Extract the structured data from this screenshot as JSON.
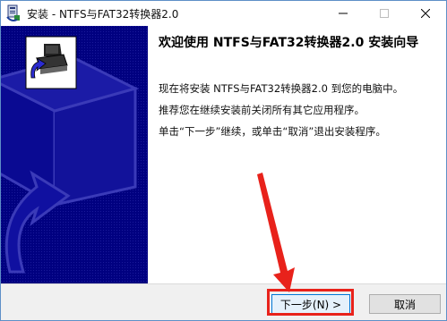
{
  "window": {
    "title": "安装 - NTFS与FAT32转换器2.0",
    "accent": "#000080"
  },
  "titlebar_icons": [
    "app-installer-icon",
    "minimize-icon",
    "maximize-icon",
    "close-icon"
  ],
  "content": {
    "heading": "欢迎使用 NTFS与FAT32转换器2.0 安装向导",
    "paragraphs": [
      "现在将安装 NTFS与FAT32转换器2.0 到您的电脑中。",
      "推荐您在继续安装前关闭所有其它应用程序。",
      "单击“下一步”继续，或单击“取消”退出安装程序。"
    ]
  },
  "buttons": {
    "next": "下一步(N) >",
    "cancel": "取消"
  },
  "annotation": {
    "highlight_color": "#e8221b"
  }
}
